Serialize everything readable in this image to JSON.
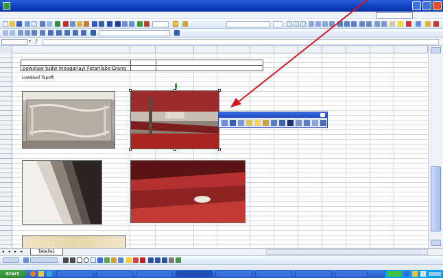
{
  "window": {
    "title": ""
  },
  "menu": {
    "items": [
      "",
      "",
      "",
      "",
      "",
      "",
      "",
      "",
      ""
    ]
  },
  "formula_bar": {
    "name_box": ""
  },
  "sheet": {
    "cell_text_1": "powstaw tudw moaganayi Fetanlabe Erang",
    "cell_text_2": "Lowdival Tapoft"
  },
  "sheet_tabs": {
    "active": "Tabelle1"
  },
  "taskbar": {
    "start_label": "Start"
  },
  "colors": {
    "title_bar": "#0c3fbf",
    "start_button": "#2f8a2f",
    "annotation_arrow": "#d8121c"
  }
}
